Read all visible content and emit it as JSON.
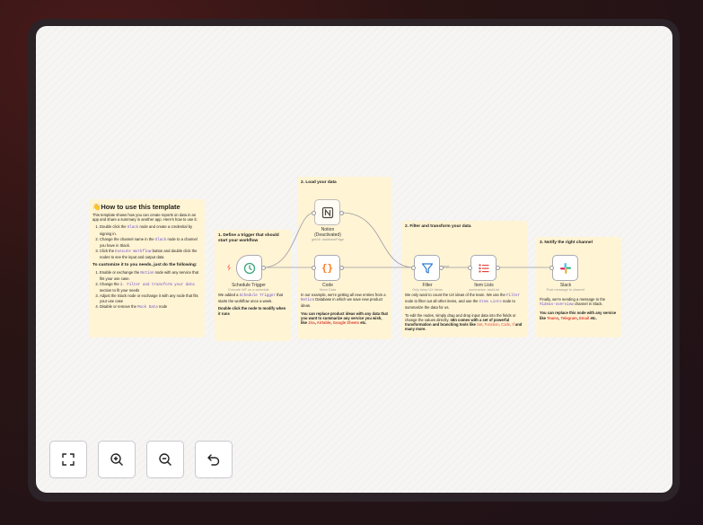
{
  "notes": {
    "howto": {
      "title": "How to use this template",
      "emoji": "👋",
      "intro": "This template shows how you can create reports on data in an app and share a summary in another app. Here's how to use it:",
      "steps": [
        {
          "a": "Double click the ",
          "code": "Slack",
          "b": " node and create a credential by signing in."
        },
        {
          "a": "Change the channel name in the ",
          "code": "Slack",
          "b": " node to a channel you have in Slack."
        },
        {
          "a": "Click the ",
          "code": "Execute Workflow",
          "b": " button and double click the nodes to see the input and output data"
        }
      ],
      "customize_title": "To customize it to you needs, just do the following:",
      "customize": [
        {
          "a": "Enable or exchange the ",
          "code": "Notion",
          "b": " node with any service that fits your use case."
        },
        {
          "a": "Change the ",
          "code": "2. Filter and transform your data",
          "b": " section to fit your needs"
        },
        {
          "a": "Adjust the Slack node or exchange it with any node that fits your use case",
          "code": "",
          "b": ""
        },
        {
          "a": "Disable or remove the ",
          "code": "Mock Data",
          "b": " node"
        }
      ]
    },
    "trigger": {
      "title": "1. Define a trigger that should start your workflow",
      "p1a": "We added a ",
      "p1code": "Schedule Trigger",
      "p1b": " that starts the workflow once a week.",
      "p2": "Double click the node to modify when it runs"
    },
    "load": {
      "title": "2. Load your data",
      "p1a": "In our example, we're getting all new entries from a ",
      "p1code": "Notion",
      "p1b": " Database in which we save new product ideas.",
      "p2a": "You can replace product ideas with any data that you want to summarize any service you wish, like ",
      "p2links": [
        "Jira",
        "Airtable",
        "Google Sheets"
      ],
      "p2b": " etc."
    },
    "transform": {
      "title": "2. Filter and transform your data",
      "p1a": "We only want to count the UX ideas of the team. We use the ",
      "p1code1": "Filter",
      "p1b": " node to filter out all other items, and use the ",
      "p1code2": "Item Lists",
      "p1c": " node to summarize the data for us.",
      "p2a": "To edit the nodes, simply drag and drop input data into the fields or change the values directly. ",
      "p2bold": "n8n comes with a set of powerful transformation and branching tools like ",
      "p2links": [
        "Set",
        "Function",
        "Code",
        "If"
      ],
      "p2end": " and many more."
    },
    "notify": {
      "title": "3. Notify the right channel",
      "p1a": "Finally, we're sending a message to the ",
      "p1code": "#ideas-overview",
      "p1b": " channel in Slack.",
      "p2a": "You can replace this node with any service like ",
      "p2links": [
        "Teams",
        "Telegram",
        "Email"
      ],
      "p2b": " etc."
    }
  },
  "nodes": {
    "schedule": {
      "name": "Schedule Trigger",
      "sub": "Execute WF on a schedule",
      "icon": "clock-icon"
    },
    "notion": {
      "name": "Notion",
      "state": "(Deactivated)",
      "sub": "getAll: databasePage",
      "icon": "notion-icon"
    },
    "code": {
      "name": "Code",
      "sub": "Mock Data",
      "icon": "code-braces-icon"
    },
    "filter": {
      "name": "Filter",
      "sub": "Only keep UX ideas",
      "icon": "funnel-icon"
    },
    "itemlists": {
      "name": "Item Lists",
      "sub": "summarize: taskList",
      "icon": "list-icon"
    },
    "slack": {
      "name": "Slack",
      "sub": "Post message to channel",
      "icon": "slack-icon"
    }
  },
  "edge_label": "kept",
  "controls": [
    {
      "name": "fit-view-button",
      "icon": "fit-view-icon"
    },
    {
      "name": "zoom-in-button",
      "icon": "zoom-in-icon"
    },
    {
      "name": "zoom-out-button",
      "icon": "zoom-out-icon"
    },
    {
      "name": "reset-zoom-button",
      "icon": "undo-icon"
    }
  ],
  "colors": {
    "sticky": "#fff4d4",
    "accent": "#ff6d5a",
    "code_text": "#6a4fc9",
    "link": "#e0463a",
    "background": "#f6f5f4"
  }
}
